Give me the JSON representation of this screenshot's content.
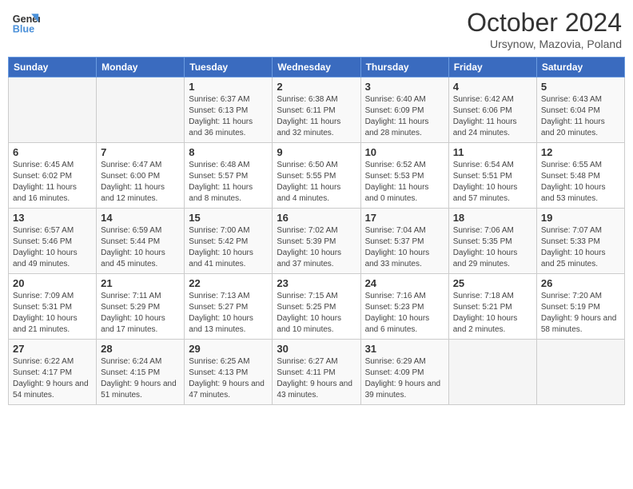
{
  "header": {
    "logo_line1": "General",
    "logo_line2": "Blue",
    "month_title": "October 2024",
    "subtitle": "Ursynow, Mazovia, Poland"
  },
  "weekdays": [
    "Sunday",
    "Monday",
    "Tuesday",
    "Wednesday",
    "Thursday",
    "Friday",
    "Saturday"
  ],
  "weeks": [
    [
      {
        "day": "",
        "info": ""
      },
      {
        "day": "",
        "info": ""
      },
      {
        "day": "1",
        "info": "Sunrise: 6:37 AM\nSunset: 6:13 PM\nDaylight: 11 hours and 36 minutes."
      },
      {
        "day": "2",
        "info": "Sunrise: 6:38 AM\nSunset: 6:11 PM\nDaylight: 11 hours and 32 minutes."
      },
      {
        "day": "3",
        "info": "Sunrise: 6:40 AM\nSunset: 6:09 PM\nDaylight: 11 hours and 28 minutes."
      },
      {
        "day": "4",
        "info": "Sunrise: 6:42 AM\nSunset: 6:06 PM\nDaylight: 11 hours and 24 minutes."
      },
      {
        "day": "5",
        "info": "Sunrise: 6:43 AM\nSunset: 6:04 PM\nDaylight: 11 hours and 20 minutes."
      }
    ],
    [
      {
        "day": "6",
        "info": "Sunrise: 6:45 AM\nSunset: 6:02 PM\nDaylight: 11 hours and 16 minutes."
      },
      {
        "day": "7",
        "info": "Sunrise: 6:47 AM\nSunset: 6:00 PM\nDaylight: 11 hours and 12 minutes."
      },
      {
        "day": "8",
        "info": "Sunrise: 6:48 AM\nSunset: 5:57 PM\nDaylight: 11 hours and 8 minutes."
      },
      {
        "day": "9",
        "info": "Sunrise: 6:50 AM\nSunset: 5:55 PM\nDaylight: 11 hours and 4 minutes."
      },
      {
        "day": "10",
        "info": "Sunrise: 6:52 AM\nSunset: 5:53 PM\nDaylight: 11 hours and 0 minutes."
      },
      {
        "day": "11",
        "info": "Sunrise: 6:54 AM\nSunset: 5:51 PM\nDaylight: 10 hours and 57 minutes."
      },
      {
        "day": "12",
        "info": "Sunrise: 6:55 AM\nSunset: 5:48 PM\nDaylight: 10 hours and 53 minutes."
      }
    ],
    [
      {
        "day": "13",
        "info": "Sunrise: 6:57 AM\nSunset: 5:46 PM\nDaylight: 10 hours and 49 minutes."
      },
      {
        "day": "14",
        "info": "Sunrise: 6:59 AM\nSunset: 5:44 PM\nDaylight: 10 hours and 45 minutes."
      },
      {
        "day": "15",
        "info": "Sunrise: 7:00 AM\nSunset: 5:42 PM\nDaylight: 10 hours and 41 minutes."
      },
      {
        "day": "16",
        "info": "Sunrise: 7:02 AM\nSunset: 5:39 PM\nDaylight: 10 hours and 37 minutes."
      },
      {
        "day": "17",
        "info": "Sunrise: 7:04 AM\nSunset: 5:37 PM\nDaylight: 10 hours and 33 minutes."
      },
      {
        "day": "18",
        "info": "Sunrise: 7:06 AM\nSunset: 5:35 PM\nDaylight: 10 hours and 29 minutes."
      },
      {
        "day": "19",
        "info": "Sunrise: 7:07 AM\nSunset: 5:33 PM\nDaylight: 10 hours and 25 minutes."
      }
    ],
    [
      {
        "day": "20",
        "info": "Sunrise: 7:09 AM\nSunset: 5:31 PM\nDaylight: 10 hours and 21 minutes."
      },
      {
        "day": "21",
        "info": "Sunrise: 7:11 AM\nSunset: 5:29 PM\nDaylight: 10 hours and 17 minutes."
      },
      {
        "day": "22",
        "info": "Sunrise: 7:13 AM\nSunset: 5:27 PM\nDaylight: 10 hours and 13 minutes."
      },
      {
        "day": "23",
        "info": "Sunrise: 7:15 AM\nSunset: 5:25 PM\nDaylight: 10 hours and 10 minutes."
      },
      {
        "day": "24",
        "info": "Sunrise: 7:16 AM\nSunset: 5:23 PM\nDaylight: 10 hours and 6 minutes."
      },
      {
        "day": "25",
        "info": "Sunrise: 7:18 AM\nSunset: 5:21 PM\nDaylight: 10 hours and 2 minutes."
      },
      {
        "day": "26",
        "info": "Sunrise: 7:20 AM\nSunset: 5:19 PM\nDaylight: 9 hours and 58 minutes."
      }
    ],
    [
      {
        "day": "27",
        "info": "Sunrise: 6:22 AM\nSunset: 4:17 PM\nDaylight: 9 hours and 54 minutes."
      },
      {
        "day": "28",
        "info": "Sunrise: 6:24 AM\nSunset: 4:15 PM\nDaylight: 9 hours and 51 minutes."
      },
      {
        "day": "29",
        "info": "Sunrise: 6:25 AM\nSunset: 4:13 PM\nDaylight: 9 hours and 47 minutes."
      },
      {
        "day": "30",
        "info": "Sunrise: 6:27 AM\nSunset: 4:11 PM\nDaylight: 9 hours and 43 minutes."
      },
      {
        "day": "31",
        "info": "Sunrise: 6:29 AM\nSunset: 4:09 PM\nDaylight: 9 hours and 39 minutes."
      },
      {
        "day": "",
        "info": ""
      },
      {
        "day": "",
        "info": ""
      }
    ]
  ]
}
